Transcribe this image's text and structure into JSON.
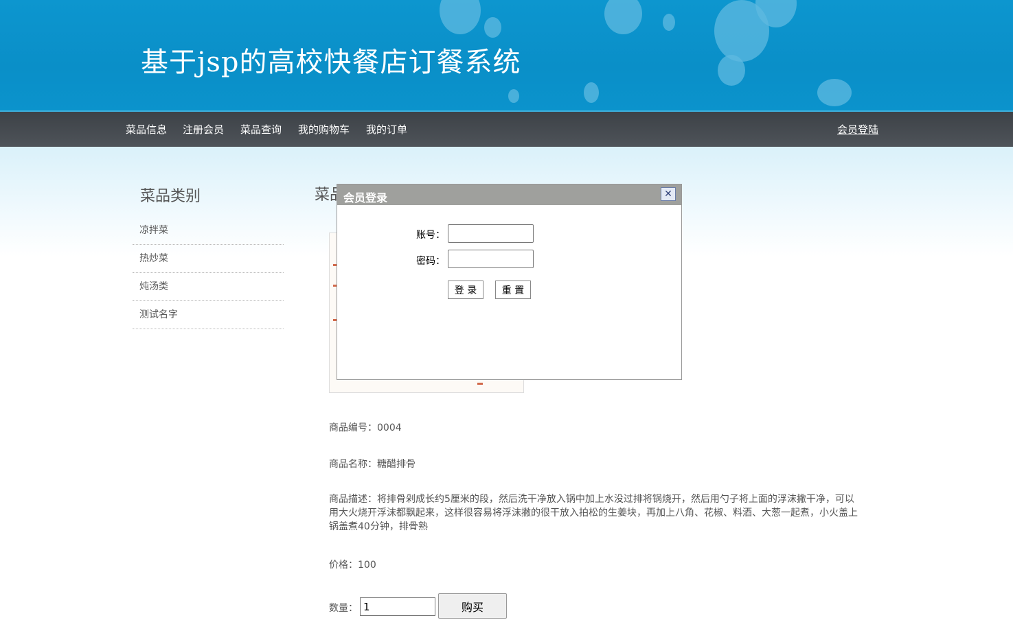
{
  "header": {
    "title": "基于jsp的高校快餐店订餐系统"
  },
  "nav": {
    "items": [
      "菜品信息",
      "注册会员",
      "菜品查询",
      "我的购物车",
      "我的订单"
    ],
    "login_link": "会员登陆"
  },
  "sidebar": {
    "title": "菜品类别",
    "categories": [
      "凉拌菜",
      "热炒菜",
      "炖汤类",
      "测试名字"
    ]
  },
  "main": {
    "title": "菜品",
    "product_id": "商品编号：0004",
    "product_name": "商品名称：糖醋排骨",
    "product_desc": "商品描述：将排骨剁成长约5厘米的段，然后洗干净放入锅中加上水没过排将锅烧开，然后用勺子将上面的浮沫撇干净，可以用大火烧开浮沫都飘起来，这样很容易将浮沫撇的很干放入拍松的生姜块，再加上八角、花椒、料酒、大葱一起煮，小火盖上锅盖煮40分钟，排骨熟",
    "price": "价格：100",
    "quantity_label": "数量：",
    "quantity_value": "1",
    "buy_button": "购买"
  },
  "login_dialog": {
    "title": "会员登录",
    "close_symbol": "✕",
    "account_label": "账号：",
    "password_label": "密码：",
    "login_button": "登 录",
    "reset_button": "重 置"
  },
  "colors": {
    "banner": "#0b93cc",
    "nav_bg": "#4a4f55",
    "dialog_header": "#9fa09d"
  }
}
